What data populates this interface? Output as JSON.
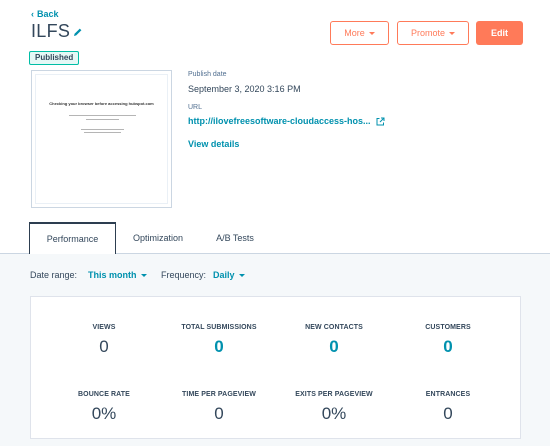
{
  "header": {
    "back_label": "Back",
    "title": "ILFS",
    "status": "Published",
    "buttons": {
      "more": "More",
      "promote": "Promote",
      "edit": "Edit"
    }
  },
  "preview": {
    "heading": "Checking your browser before accessing hubspot.com"
  },
  "details": {
    "publish_date_label": "Publish date",
    "publish_date_value": "September 3, 2020 3:16 PM",
    "url_label": "URL",
    "url_value": "http://ilovefreesoftware-cloudaccess-hos...",
    "view_details": "View details"
  },
  "tabs": [
    {
      "label": "Performance",
      "active": true
    },
    {
      "label": "Optimization",
      "active": false
    },
    {
      "label": "A/B Tests",
      "active": false
    }
  ],
  "filters": {
    "date_range_label": "Date range:",
    "date_range_value": "This month",
    "frequency_label": "Frequency:",
    "frequency_value": "Daily"
  },
  "stats": [
    {
      "label": "VIEWS",
      "value": "0",
      "link": false
    },
    {
      "label": "TOTAL SUBMISSIONS",
      "value": "0",
      "link": true
    },
    {
      "label": "NEW CONTACTS",
      "value": "0",
      "link": true
    },
    {
      "label": "CUSTOMERS",
      "value": "0",
      "link": true
    },
    {
      "label": "BOUNCE RATE",
      "value": "0%",
      "link": false
    },
    {
      "label": "TIME PER PAGEVIEW",
      "value": "0",
      "link": false
    },
    {
      "label": "EXITS PER PAGEVIEW",
      "value": "0%",
      "link": false
    },
    {
      "label": "ENTRANCES",
      "value": "0",
      "link": false
    }
  ],
  "colors": {
    "accent": "#ff7a59",
    "link": "#0091ae",
    "text": "#33475b",
    "published_border": "#00bda5"
  }
}
